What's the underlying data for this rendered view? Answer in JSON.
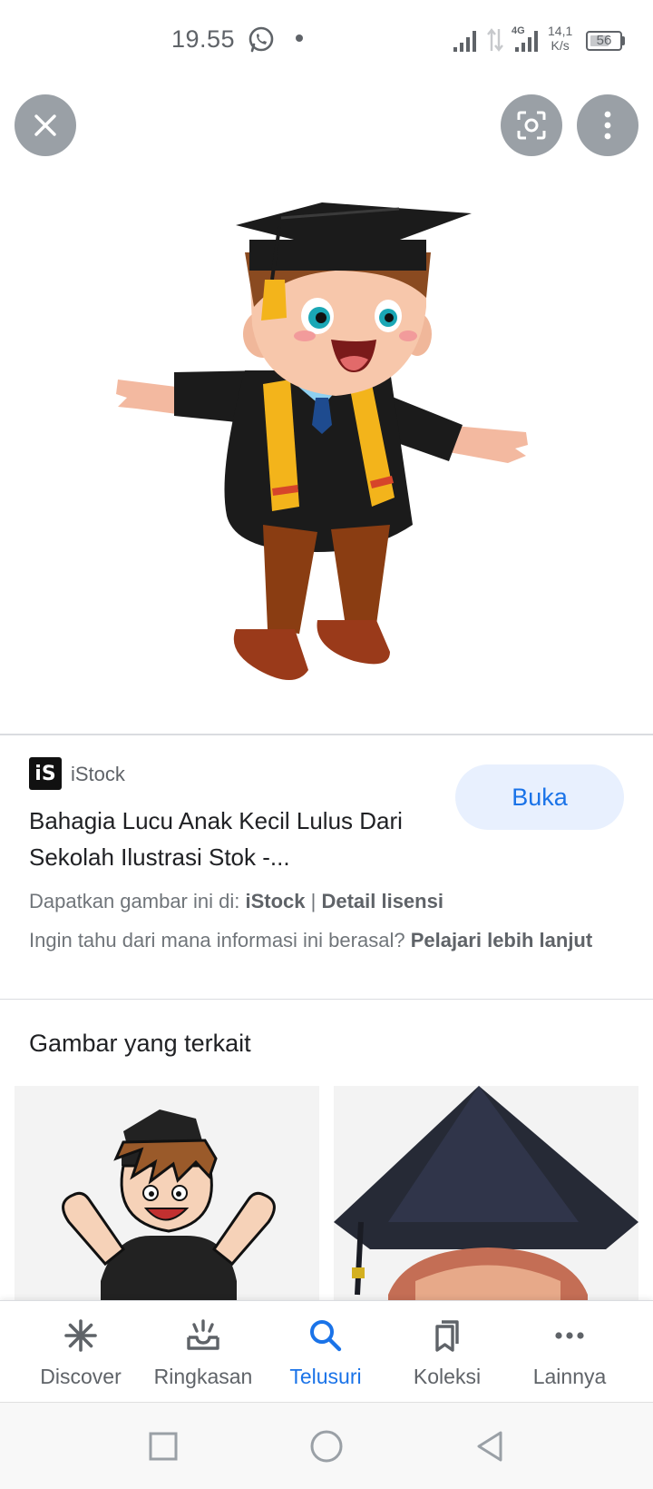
{
  "status_bar": {
    "time": "19.55",
    "network": "4G",
    "speed_value": "14,1",
    "speed_unit": "K/s",
    "battery": "56"
  },
  "viewer": {
    "close_icon": "close-icon",
    "lens_icon": "google-lens-icon",
    "more_icon": "more-vert-icon"
  },
  "source": {
    "logo_text": "iS",
    "name": "iStock"
  },
  "result": {
    "title": "Bahagia Lucu Anak Kecil Lulus Dari Sekolah Ilustrasi Stok -...",
    "open_label": "Buka"
  },
  "license": {
    "prefix": "Dapatkan gambar ini di: ",
    "source": "iStock",
    "separator": " | ",
    "detail": "Detail lisensi"
  },
  "info": {
    "question": "Ingin tahu dari mana informasi ini berasal? ",
    "learn_more": "Pelajari lebih lanjut"
  },
  "related": {
    "title": "Gambar yang terkait"
  },
  "bottom_nav": {
    "items": [
      {
        "label": "Discover",
        "icon": "asterisk-icon"
      },
      {
        "label": "Ringkasan",
        "icon": "inbox-sparkle-icon"
      },
      {
        "label": "Telusuri",
        "icon": "search-icon"
      },
      {
        "label": "Koleksi",
        "icon": "bookmarks-icon"
      },
      {
        "label": "Lainnya",
        "icon": "more-horiz-icon"
      }
    ],
    "active_index": 2
  },
  "colors": {
    "accent": "#1a73e8",
    "button_bg": "#e8f0fe",
    "gray_text": "#5f6368"
  }
}
